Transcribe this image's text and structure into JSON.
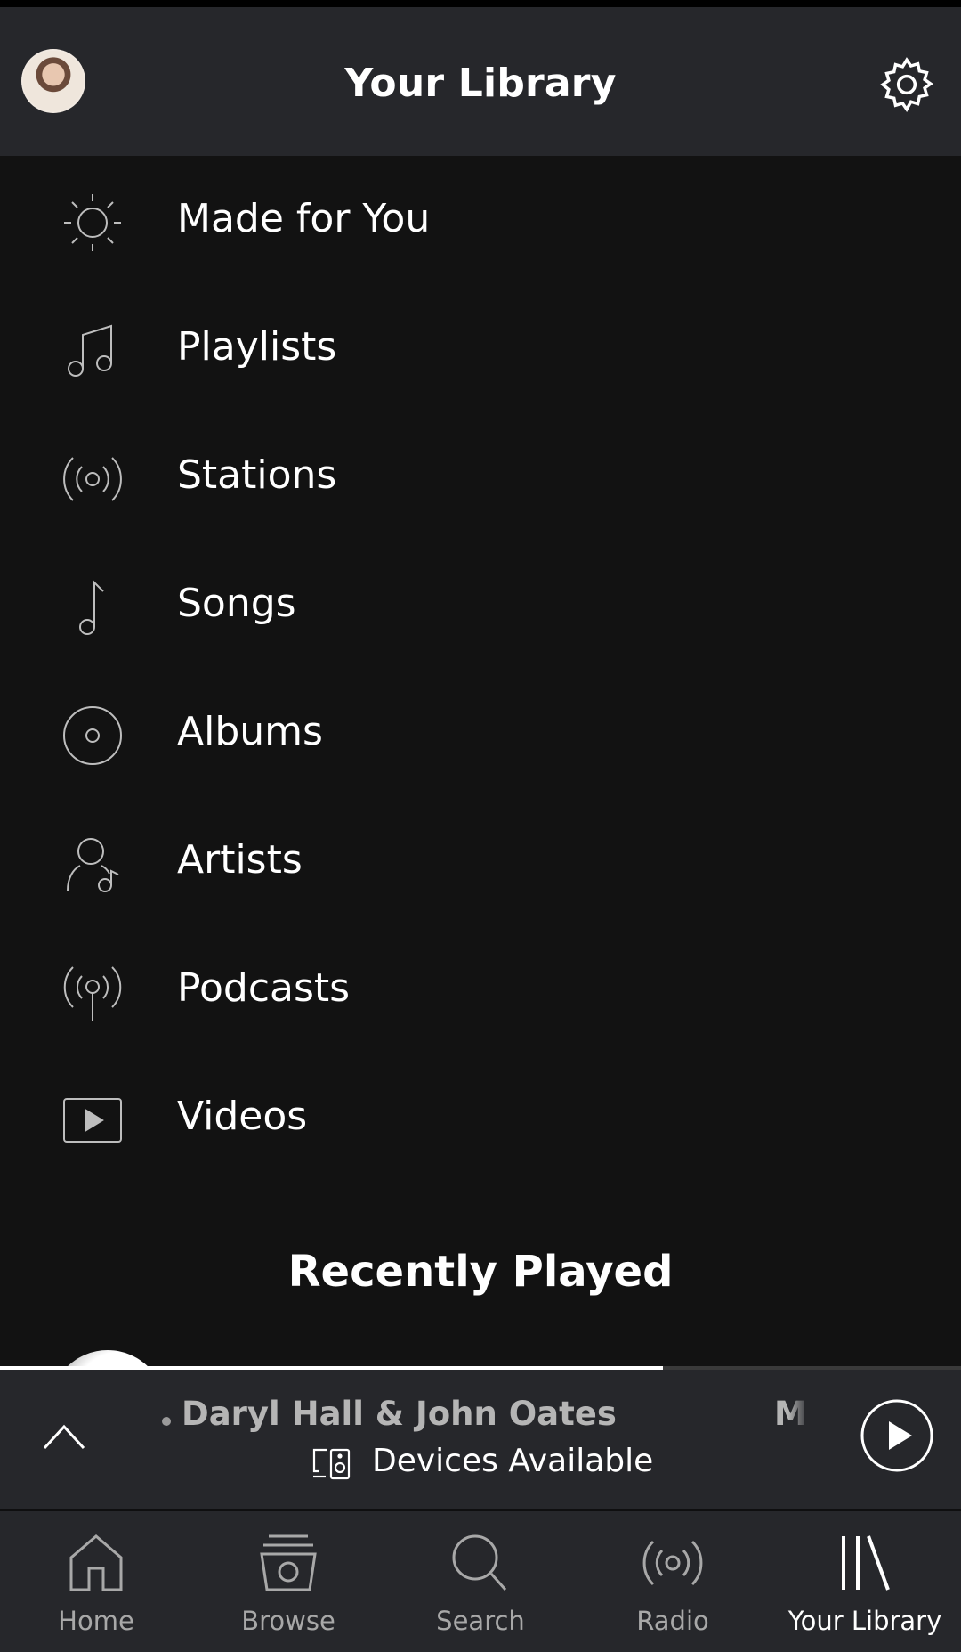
{
  "header": {
    "title": "Your Library"
  },
  "menu": {
    "items": [
      {
        "label": "Made for You",
        "icon": "sun-icon"
      },
      {
        "label": "Playlists",
        "icon": "music-notes-icon"
      },
      {
        "label": "Stations",
        "icon": "radio-waves-icon"
      },
      {
        "label": "Songs",
        "icon": "music-note-icon"
      },
      {
        "label": "Albums",
        "icon": "album-disc-icon"
      },
      {
        "label": "Artists",
        "icon": "artist-icon"
      },
      {
        "label": "Podcasts",
        "icon": "podcast-icon"
      },
      {
        "label": "Videos",
        "icon": "video-play-icon"
      }
    ]
  },
  "recent": {
    "title": "Recently Played"
  },
  "now_playing": {
    "artist": "Daryl Hall & John Oates",
    "next_text": "M",
    "devices_label": "Devices Available",
    "progress": 0.69
  },
  "tabs": [
    {
      "label": "Home",
      "icon": "home-icon",
      "active": false
    },
    {
      "label": "Browse",
      "icon": "browse-icon",
      "active": false
    },
    {
      "label": "Search",
      "icon": "search-icon",
      "active": false
    },
    {
      "label": "Radio",
      "icon": "radio-icon",
      "active": false
    },
    {
      "label": "Your Library",
      "icon": "library-icon",
      "active": true
    }
  ],
  "colors": {
    "background": "#121212",
    "header_bg": "#26272b",
    "inactive_tab": "#a8a8a8",
    "active_tab": "#ffffff"
  }
}
